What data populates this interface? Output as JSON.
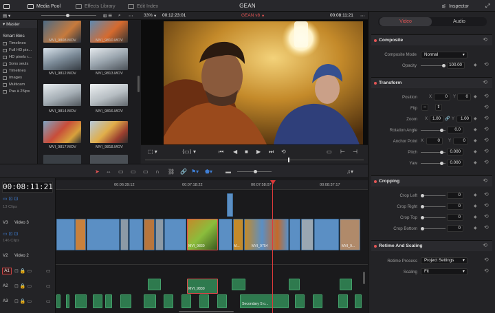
{
  "topbar": {
    "media_pool": "Media Pool",
    "effects_library": "Effects Library",
    "edit_index": "Edit Index",
    "title": "GEAN",
    "inspector": "Inspector"
  },
  "viewer_bar": {
    "zoom": "33%",
    "source_timecode": "00:12:23:01",
    "timeline_name": "GEAN v8",
    "record_timecode": "00:08:11:21"
  },
  "bins": {
    "master": "Master",
    "smart_bins_title": "Smart Bins",
    "items": [
      "Timelines",
      "Full HD pix...",
      "HD pixels r...",
      "Sons seuls",
      "Timelines",
      "Images",
      "Multicam",
      "Pas à 25ips"
    ]
  },
  "pool": {
    "clips": [
      "MVI_9808.MOV",
      "MVI_9810.MOV",
      "MVI_9812.MOV",
      "MVI_9813.MOV",
      "MVI_9814.MOV",
      "MVI_9816.MOV",
      "MVI_9817.MOV",
      "MVI_9818.MOV"
    ]
  },
  "timeline": {
    "timecode": "00:08:11:21",
    "ruler": [
      "00:06:39:12",
      "00:07:18:22",
      "00:07:58:07",
      "00:08:37:17"
    ],
    "tracks": {
      "v4_count": "13 Clips",
      "v3_label": "V3",
      "v3_name": "Video 3",
      "v3_count": "146 Clips",
      "v2_label": "V2",
      "v2_name": "Video 2",
      "a1_label": "A1",
      "a2_label": "A2",
      "a3_label": "A3"
    },
    "clip_names": {
      "v_selected": "MVI_9830",
      "v_short": "M...",
      "v_9754": "MVI_9754",
      "v_tail": "MVI_9...",
      "a_selected": "MVI_9830",
      "a3_secondary": "Secondary S o..."
    }
  },
  "inspector": {
    "tab_video": "Video",
    "tab_audio": "Audio",
    "composite": {
      "title": "Composite",
      "mode_label": "Composite Mode",
      "mode_value": "Normal",
      "opacity_label": "Opacity",
      "opacity_value": "100.00"
    },
    "transform": {
      "title": "Transform",
      "position_label": "Position",
      "position_x": "0",
      "position_y": "0",
      "flip_label": "Flip",
      "zoom_label": "Zoom",
      "zoom_x": "1.00",
      "zoom_y": "1.00",
      "rotation_label": "Rotation Angle",
      "rotation_value": "0.0",
      "anchor_label": "Anchor Point",
      "anchor_x": "0",
      "anchor_y": "0",
      "pitch_label": "Pitch",
      "pitch_value": "0.000",
      "yaw_label": "Yaw",
      "yaw_value": "0.000",
      "x_axis": "X",
      "y_axis": "Y"
    },
    "cropping": {
      "title": "Cropping",
      "left_label": "Crop Left",
      "left_value": "0",
      "right_label": "Crop Right",
      "right_value": "0",
      "top_label": "Crop Top",
      "top_value": "0",
      "bottom_label": "Crop Bottom",
      "bottom_value": "0"
    },
    "retime": {
      "title": "Retime And Scaling",
      "process_label": "Retime Process",
      "process_value": "Project Settings",
      "scaling_label": "Scaling",
      "scaling_value": "Fit"
    }
  },
  "colors": {
    "video_clip": "#5b8fc4",
    "audio_clip": "#2e7a4e",
    "playhead": "#e03a3a",
    "timeline_name": "#e05353"
  }
}
